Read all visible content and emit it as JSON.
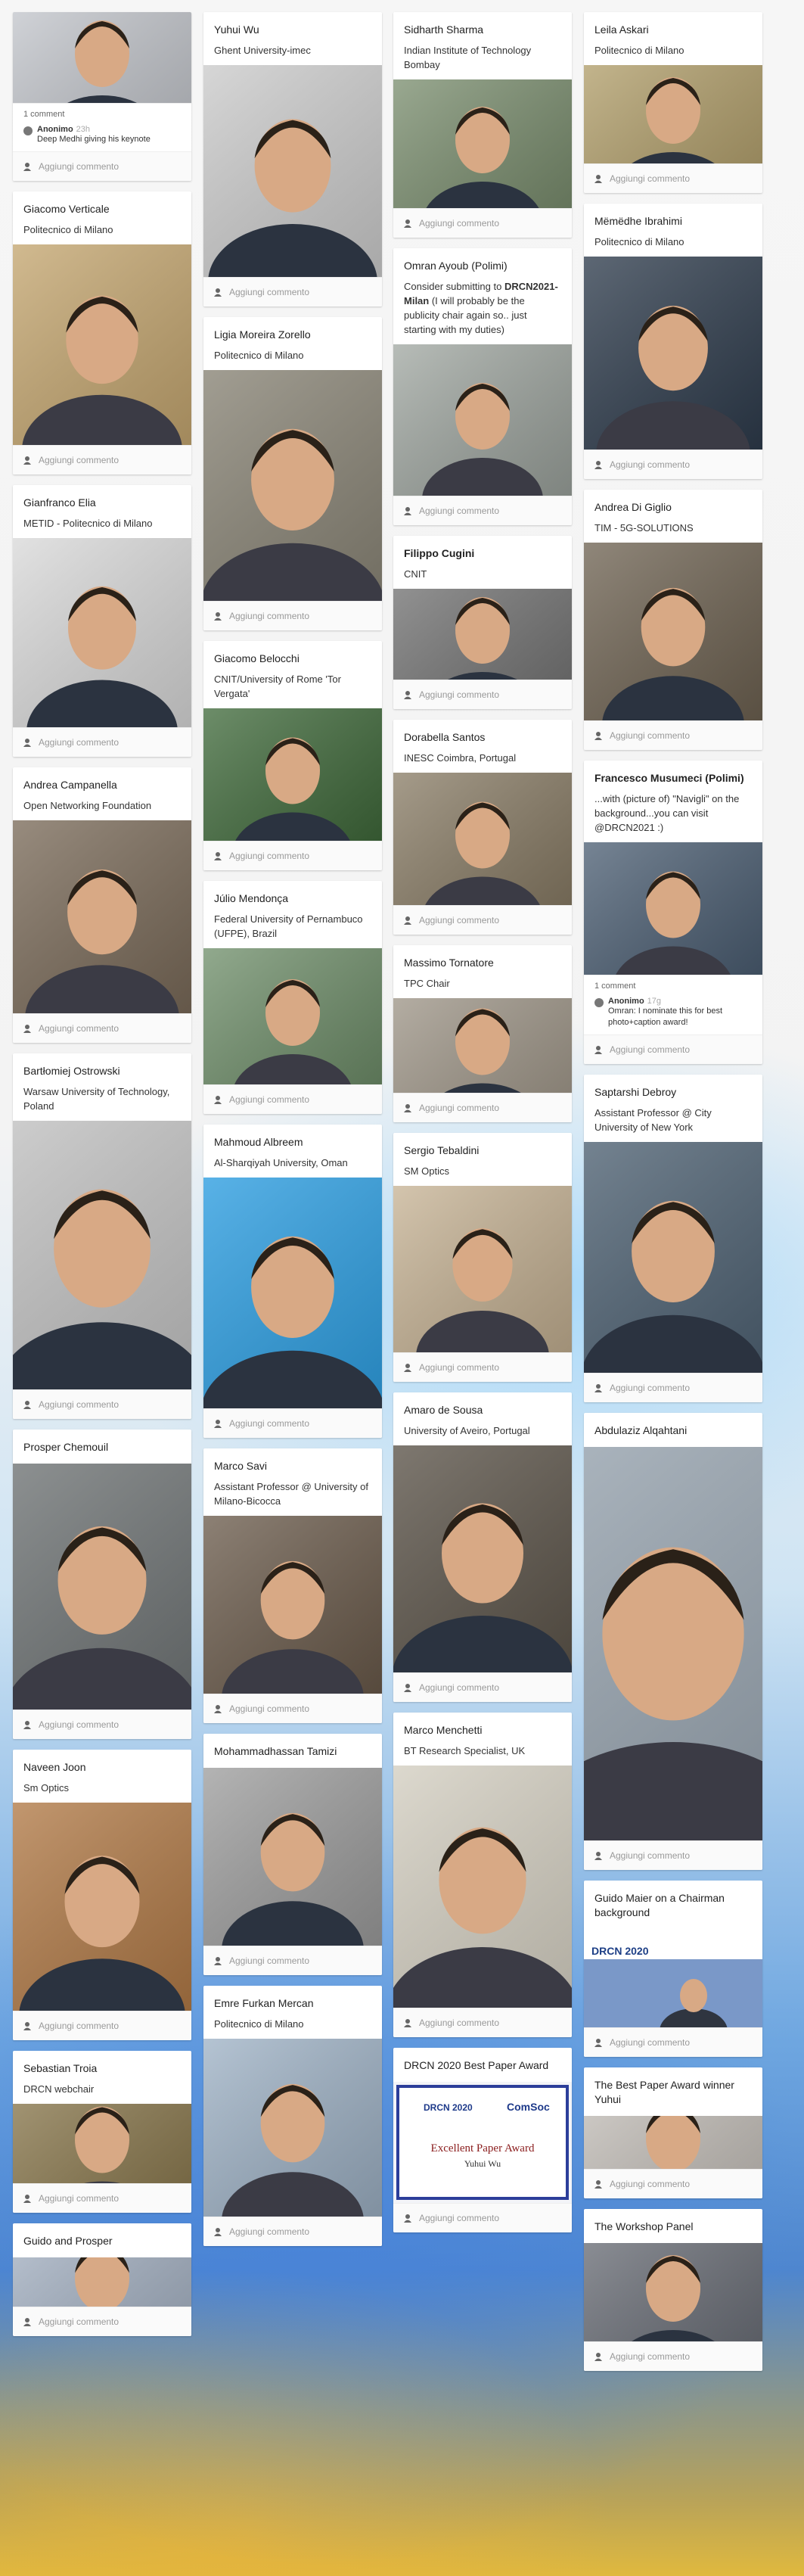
{
  "add_comment_label": "Aggiungi commento",
  "col1": [
    {
      "title": "",
      "sub": "",
      "photo_h": 120,
      "photo_tone": "#c9ccd2",
      "comments": {
        "count": "1 comment",
        "author": "Anonimo",
        "time": "23h",
        "text": "Deep Medhi giving his keynote"
      }
    },
    {
      "title": "Giacomo Verticale",
      "sub": "Politecnico di Milano",
      "photo_h": 265,
      "photo_tone": "#c7a870"
    },
    {
      "title": "Gianfranco Elia",
      "sub": "METID - Politecnico di Milano",
      "photo_h": 250,
      "photo_tone": "#dcdcdc"
    },
    {
      "title": "Andrea Campanella",
      "sub": "Open Networking Foundation",
      "photo_h": 255,
      "photo_tone": "#7a6a58"
    },
    {
      "title": "Bartłomiej Ostrowski",
      "sub": "Warsaw University of Technology, Poland",
      "photo_h": 355,
      "photo_tone": "#c5c5c5"
    },
    {
      "title": "Prosper Chemouil",
      "sub": "",
      "photo_h": 325,
      "photo_tone": "#6f7475"
    },
    {
      "title": "Naveen Joon",
      "sub": "Sm Optics",
      "photo_h": 275,
      "photo_tone": "#b37a45"
    },
    {
      "title": "Sebastian Troia",
      "sub": "DRCN webchair",
      "photo_h": 105,
      "photo_tone": "#8c7a4e"
    },
    {
      "title": "Guido and Prosper",
      "sub": "",
      "photo_h": 65,
      "photo_tone": "#a9b6c8"
    }
  ],
  "col2": [
    {
      "title": "Yuhui Wu",
      "sub": "Ghent University-imec",
      "photo_h": 280,
      "photo_tone": "#cfcfcf"
    },
    {
      "title": "Ligia Moreira Zorello",
      "sub": "Politecnico di Milano",
      "photo_h": 305,
      "photo_tone": "#8a8576"
    },
    {
      "title": "Giacomo Belocchi",
      "sub": "CNIT/University of Rome 'Tor Vergata'",
      "photo_h": 175,
      "photo_tone": "#3f6a3a"
    },
    {
      "title": "Júlio Mendonça",
      "sub": "Federal University of Pernambuco (UFPE), Brazil",
      "photo_h": 180,
      "photo_tone": "#6f8f6a"
    },
    {
      "title": "Mahmoud Albreem",
      "sub": "Al-Sharqiyah University, Oman",
      "photo_h": 305,
      "photo_tone": "#2aa0e6"
    },
    {
      "title": "Marco Savi",
      "sub": "Assistant Professor @ University of Milano-Bicocca",
      "photo_h": 235,
      "photo_tone": "#6a5a4a"
    },
    {
      "title": "Mohammadhassan Tamizi",
      "sub": "",
      "photo_h": 235,
      "photo_tone": "#9e9e9e"
    },
    {
      "title": "Emre Furkan Mercan",
      "sub": "Politecnico di Milano",
      "photo_h": 235,
      "photo_tone": "#9fb3c7"
    }
  ],
  "col3": [
    {
      "title": "Sidharth Sharma",
      "sub": "Indian Institute of Technology Bombay",
      "photo_h": 170,
      "photo_tone": "#7b8f6f"
    },
    {
      "title": "Omran Ayoub (Polimi)",
      "sub": "Consider submitting to",
      "sub_bold": "DRCN2021-Milan",
      "sub_rest": " (I will probably be the publicity chair again so.. just starting with my duties)",
      "photo_h": 200,
      "photo_tone": "#9fa6a0"
    },
    {
      "title": "Filippo Cugini",
      "title_bold": true,
      "sub": "CNIT",
      "photo_h": 120,
      "photo_tone": "#767676"
    },
    {
      "title": "Dorabella Santos",
      "sub": "INESC Coimbra, Portugal",
      "photo_h": 175,
      "photo_tone": "#8a7d66"
    },
    {
      "title": "Massimo Tornatore",
      "sub": "TPC Chair",
      "photo_h": 125,
      "photo_tone": "#a39a8c"
    },
    {
      "title": "Sergio Tebaldini",
      "sub": "SM Optics",
      "photo_h": 220,
      "photo_tone": "#c7b394"
    },
    {
      "title": "Amaro de Sousa",
      "sub": "University of Aveiro, Portugal",
      "photo_h": 300,
      "photo_tone": "#5b5348"
    },
    {
      "title": "Marco Menchetti",
      "sub": "BT Research Specialist, UK",
      "photo_h": 320,
      "photo_tone": "#d9d4c6"
    },
    {
      "title": "DRCN 2020 Best Paper Award",
      "sub": "",
      "photo_h": 160,
      "photo_tone": "#e6e8f2",
      "award": {
        "head": "DRCN 2020",
        "brand": "ComSoc",
        "line1": "Excellent Paper Award",
        "line2": "Yuhui Wu"
      }
    }
  ],
  "col4": [
    {
      "title": "Leila Askari",
      "sub": "Politecnico di Milano",
      "photo_h": 130,
      "photo_tone": "#b6a36e"
    },
    {
      "title": "Mëmëdhe Ibrahimi",
      "sub": "Politecnico di Milano",
      "photo_h": 255,
      "photo_tone": "#2c3a4b"
    },
    {
      "title": "Andrea Di Giglio",
      "sub": "TIM - 5G-SOLUTIONS",
      "photo_h": 235,
      "photo_tone": "#6e6251"
    },
    {
      "title": "Francesco Musumeci (Polimi)",
      "title_bold": true,
      "sub": "...with (picture of) \"Navigli\" on the background...you can visit @DRCN2021 :)",
      "photo_h": 175,
      "photo_tone": "#4b5e73",
      "comments": {
        "count": "1 comment",
        "author": "Anonimo",
        "time": "17g",
        "text": "Omran: I nominate this for best photo+caption award!"
      }
    },
    {
      "title": "Saptarshi Debroy",
      "sub": "Assistant Professor @ City University of New York",
      "photo_h": 305,
      "photo_tone": "#4d6173"
    },
    {
      "title": "Abdulaziz Alqahtani",
      "sub": "",
      "photo_h": 520,
      "photo_tone": "#9aa7b3"
    },
    {
      "title": "Guido Maier on a Chairman background",
      "sub": "",
      "photo_h": 130,
      "photo_tone": "#7a98c8",
      "banner": "DRCN 2020"
    },
    {
      "title": "The Best Paper Award winner Yuhui",
      "sub": "",
      "photo_h": 70,
      "photo_tone": "#c8c3bd"
    },
    {
      "title": "The Workshop Panel",
      "sub": "",
      "photo_h": 130,
      "photo_tone": "#6b6f78"
    }
  ]
}
